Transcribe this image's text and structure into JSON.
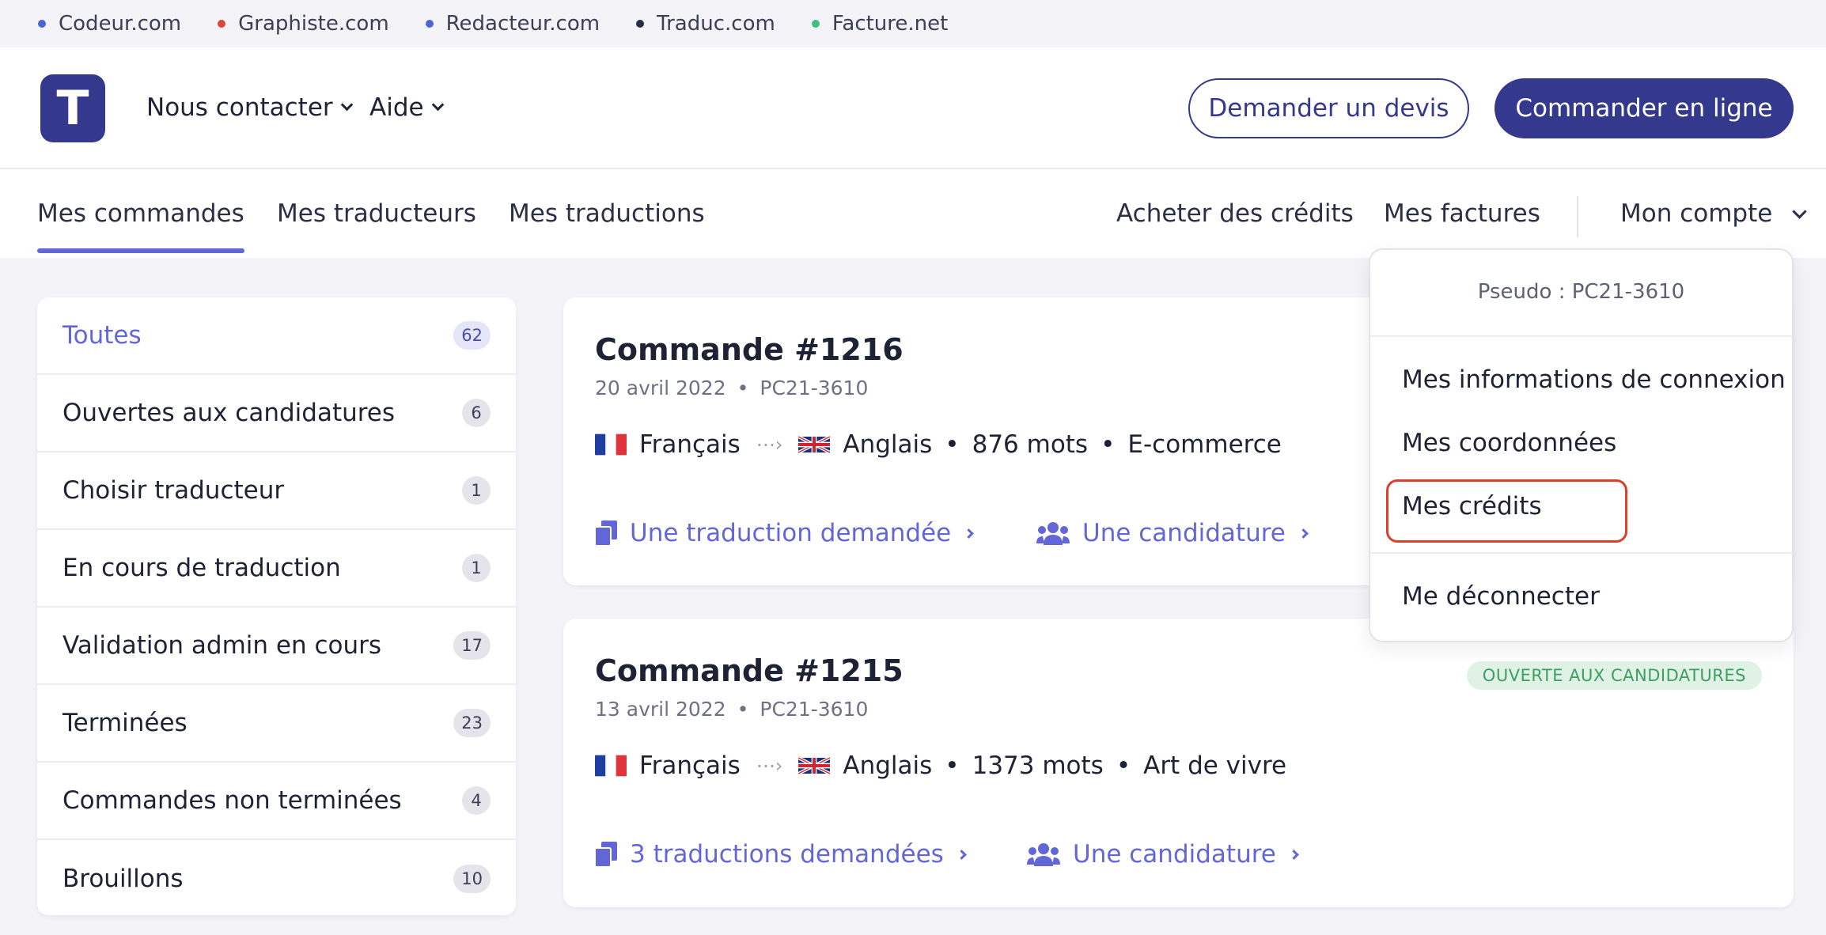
{
  "network": [
    {
      "label": "Codeur.com",
      "color": "#4b64d6"
    },
    {
      "label": "Graphiste.com",
      "color": "#d9473a"
    },
    {
      "label": "Redacteur.com",
      "color": "#4b64d6"
    },
    {
      "label": "Traduc.com",
      "color": "#2a2e4a"
    },
    {
      "label": "Facture.net",
      "color": "#3fbf80"
    }
  ],
  "header": {
    "logo_letter": "T",
    "nav": [
      "Nous contacter",
      "Aide"
    ],
    "quote_button": "Demander un devis",
    "order_button": "Commander en ligne"
  },
  "tabs": {
    "left": [
      "Mes commandes",
      "Mes traducteurs",
      "Mes traductions"
    ],
    "buy_credits": "Acheter des crédits",
    "invoices": "Mes factures",
    "account": "Mon compte"
  },
  "sidebar": [
    {
      "label": "Toutes",
      "count": "62"
    },
    {
      "label": "Ouvertes aux candidatures",
      "count": "6"
    },
    {
      "label": "Choisir traducteur",
      "count": "1"
    },
    {
      "label": "En cours de traduction",
      "count": "1"
    },
    {
      "label": "Validation admin en cours",
      "count": "17"
    },
    {
      "label": "Terminées",
      "count": "23"
    },
    {
      "label": "Commandes non terminées",
      "count": "4"
    },
    {
      "label": "Brouillons",
      "count": "10"
    }
  ],
  "orders": [
    {
      "title": "Commande #1216",
      "date": "20 avril 2022",
      "pseudo": "PC21-3610",
      "source_lang": "Français",
      "target_lang": "Anglais",
      "words": "876 mots",
      "category": "E-commerce",
      "translations_link": "Une traduction demandée",
      "applications_link": "Une candidature",
      "status": ""
    },
    {
      "title": "Commande #1215",
      "date": "13 avril 2022",
      "pseudo": "PC21-3610",
      "source_lang": "Français",
      "target_lang": "Anglais",
      "words": "1373 mots",
      "category": "Art de vivre",
      "translations_link": "3 traductions demandées",
      "applications_link": "Une candidature",
      "status": "OUVERTE AUX CANDIDATURES"
    }
  ],
  "account_menu": {
    "pseudo": "Pseudo : PC21-3610",
    "items": [
      "Mes informations de connexion",
      "Mes coordonnées",
      "Mes crédits"
    ],
    "logout": "Me déconnecter"
  },
  "colors": {
    "brand": "#35398e",
    "accent": "#6266d6",
    "status_green": "#3f9e62",
    "highlight": "#d9412c"
  }
}
